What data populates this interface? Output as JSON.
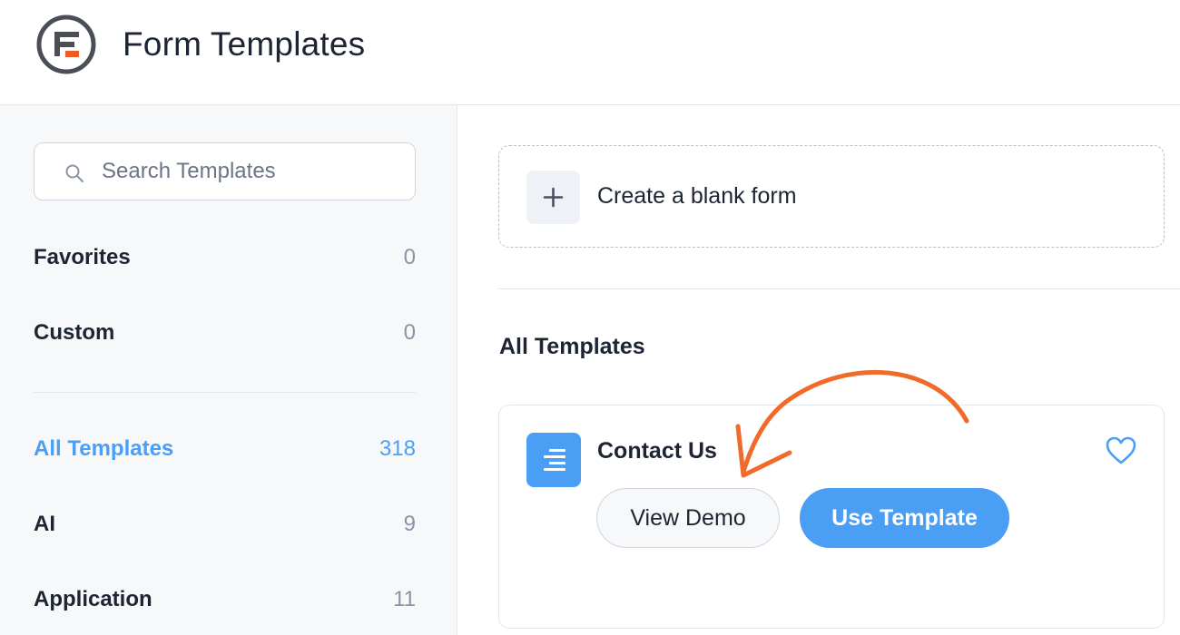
{
  "header": {
    "title": "Form Templates",
    "logo_icon": "formidable-logo-icon"
  },
  "sidebar": {
    "search": {
      "placeholder": "Search Templates",
      "value": "",
      "icon": "search-icon"
    },
    "categories_top": [
      {
        "label": "Favorites",
        "count": "0"
      },
      {
        "label": "Custom",
        "count": "0"
      }
    ],
    "categories": [
      {
        "label": "All Templates",
        "count": "318",
        "active": true
      },
      {
        "label": "AI",
        "count": "9"
      },
      {
        "label": "Application",
        "count": "11"
      }
    ]
  },
  "main": {
    "blank_form": {
      "label": "Create a blank form",
      "icon": "plus-icon"
    },
    "section_title": "All Templates",
    "template": {
      "name": "Contact Us",
      "icon": "align-right-icon",
      "favorite_icon": "heart-icon",
      "view_demo_label": "View Demo",
      "use_template_label": "Use Template"
    }
  },
  "colors": {
    "accent": "#4a9ff5",
    "annotation_arrow": "#f06a2a",
    "logo_orange": "#f05a28",
    "text": "#1d2433",
    "muted": "#8a94a6"
  }
}
